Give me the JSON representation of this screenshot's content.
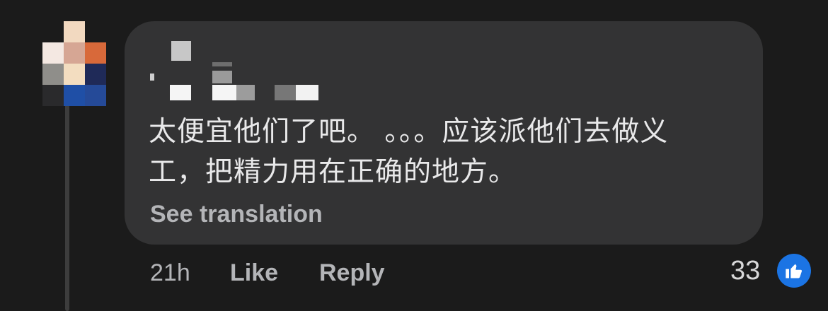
{
  "comment": {
    "text_lines": [
      "太便宜他们了吧。 。。。应该派他们去做义",
      "工，把精力用在正确的地方。"
    ],
    "see_translation_label": "See translation"
  },
  "actions": {
    "time": "21h",
    "like_label": "Like",
    "reply_label": "Reply"
  },
  "reactions": {
    "count": "33",
    "icon": "thumbs-up-icon"
  },
  "colors": {
    "background": "#1b1b1b",
    "bubble": "#333334",
    "secondary_text": "#b4b5b8",
    "primary_text": "#e9e9ea",
    "like_badge": "#1b74e4"
  }
}
